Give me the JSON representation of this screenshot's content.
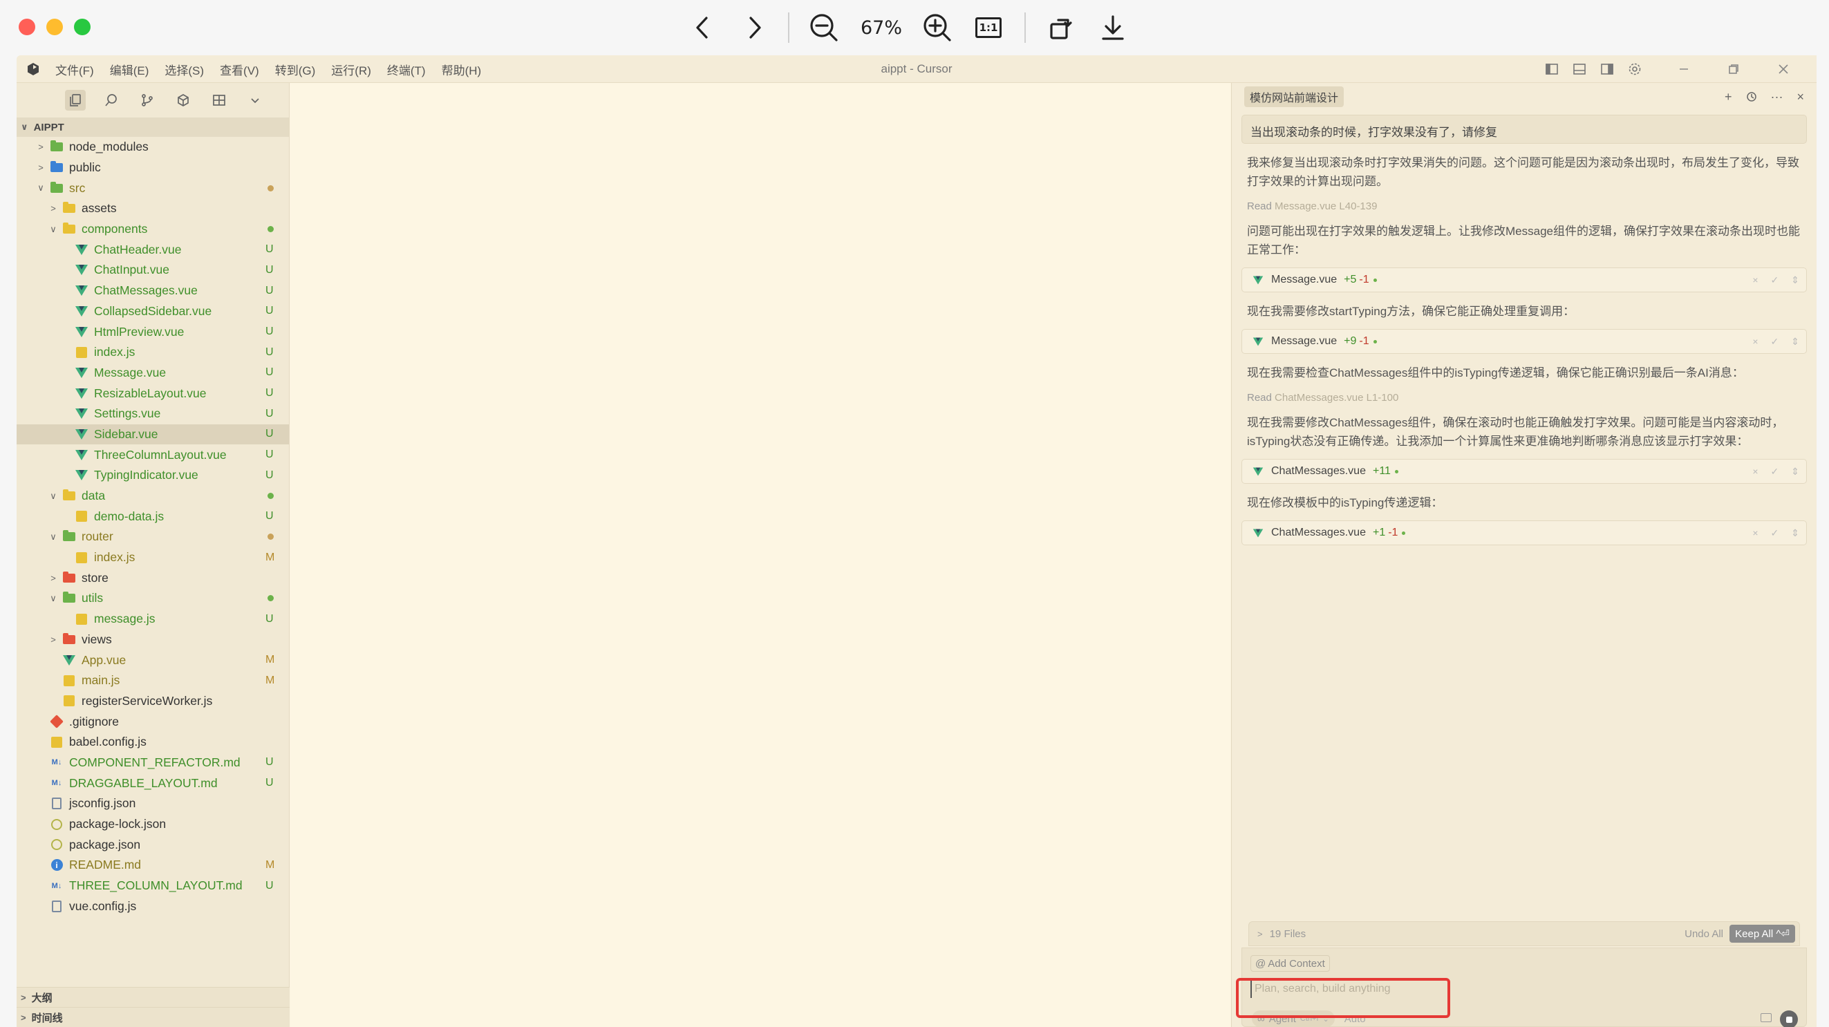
{
  "viewer": {
    "zoom": "67%",
    "actual_size_label": "1:1"
  },
  "window": {
    "title": "aippt - Cursor",
    "menu": [
      "文件(F)",
      "编辑(E)",
      "选择(S)",
      "查看(V)",
      "转到(G)",
      "运行(R)",
      "终端(T)",
      "帮助(H)"
    ]
  },
  "sidebar": {
    "root": "AIPPT",
    "tree": [
      {
        "indent": 0,
        "chev": ">",
        "icon": "folder-green",
        "name": "node_modules",
        "color": "",
        "status": ""
      },
      {
        "indent": 0,
        "chev": ">",
        "icon": "folder-blue",
        "name": "public",
        "color": "",
        "status": ""
      },
      {
        "indent": 0,
        "chev": "v",
        "icon": "folder-green",
        "name": "src",
        "color": "olive",
        "status": "dot-y"
      },
      {
        "indent": 1,
        "chev": ">",
        "icon": "folder-yellow",
        "name": "assets",
        "color": "",
        "status": ""
      },
      {
        "indent": 1,
        "chev": "v",
        "icon": "folder-yellow",
        "name": "components",
        "color": "green",
        "status": "dot-g"
      },
      {
        "indent": 2,
        "chev": "",
        "icon": "vue",
        "name": "ChatHeader.vue",
        "color": "green",
        "status": "U"
      },
      {
        "indent": 2,
        "chev": "",
        "icon": "vue",
        "name": "ChatInput.vue",
        "color": "green",
        "status": "U"
      },
      {
        "indent": 2,
        "chev": "",
        "icon": "vue",
        "name": "ChatMessages.vue",
        "color": "green",
        "status": "U"
      },
      {
        "indent": 2,
        "chev": "",
        "icon": "vue",
        "name": "CollapsedSidebar.vue",
        "color": "green",
        "status": "U"
      },
      {
        "indent": 2,
        "chev": "",
        "icon": "vue",
        "name": "HtmlPreview.vue",
        "color": "green",
        "status": "U"
      },
      {
        "indent": 2,
        "chev": "",
        "icon": "js",
        "name": "index.js",
        "color": "green",
        "status": "U"
      },
      {
        "indent": 2,
        "chev": "",
        "icon": "vue",
        "name": "Message.vue",
        "color": "green",
        "status": "U"
      },
      {
        "indent": 2,
        "chev": "",
        "icon": "vue",
        "name": "ResizableLayout.vue",
        "color": "green",
        "status": "U"
      },
      {
        "indent": 2,
        "chev": "",
        "icon": "vue",
        "name": "Settings.vue",
        "color": "green",
        "status": "U"
      },
      {
        "indent": 2,
        "chev": "",
        "icon": "vue",
        "name": "Sidebar.vue",
        "color": "green",
        "status": "U",
        "selected": true
      },
      {
        "indent": 2,
        "chev": "",
        "icon": "vue",
        "name": "ThreeColumnLayout.vue",
        "color": "green",
        "status": "U"
      },
      {
        "indent": 2,
        "chev": "",
        "icon": "vue",
        "name": "TypingIndicator.vue",
        "color": "green",
        "status": "U"
      },
      {
        "indent": 1,
        "chev": "v",
        "icon": "folder-yellow",
        "name": "data",
        "color": "green",
        "status": "dot-g"
      },
      {
        "indent": 2,
        "chev": "",
        "icon": "js",
        "name": "demo-data.js",
        "color": "green",
        "status": "U"
      },
      {
        "indent": 1,
        "chev": "v",
        "icon": "folder-green",
        "name": "router",
        "color": "olive",
        "status": "dot-y"
      },
      {
        "indent": 2,
        "chev": "",
        "icon": "js",
        "name": "index.js",
        "color": "olive",
        "status": "M"
      },
      {
        "indent": 1,
        "chev": ">",
        "icon": "folder-red",
        "name": "store",
        "color": "",
        "status": ""
      },
      {
        "indent": 1,
        "chev": "v",
        "icon": "folder-green",
        "name": "utils",
        "color": "green",
        "status": "dot-g"
      },
      {
        "indent": 2,
        "chev": "",
        "icon": "js",
        "name": "message.js",
        "color": "green",
        "status": "U"
      },
      {
        "indent": 1,
        "chev": ">",
        "icon": "folder-red",
        "name": "views",
        "color": "",
        "status": ""
      },
      {
        "indent": 1,
        "chev": "",
        "icon": "vue",
        "name": "App.vue",
        "color": "olive",
        "status": "M"
      },
      {
        "indent": 1,
        "chev": "",
        "icon": "js",
        "name": "main.js",
        "color": "olive",
        "status": "M"
      },
      {
        "indent": 1,
        "chev": "",
        "icon": "js",
        "name": "registerServiceWorker.js",
        "color": "",
        "status": ""
      },
      {
        "indent": 0,
        "chev": "",
        "icon": "git",
        "name": ".gitignore",
        "color": "",
        "status": ""
      },
      {
        "indent": 0,
        "chev": "",
        "icon": "js",
        "name": "babel.config.js",
        "color": "",
        "status": ""
      },
      {
        "indent": 0,
        "chev": "",
        "icon": "md",
        "name": "COMPONENT_REFACTOR.md",
        "color": "green",
        "status": "U"
      },
      {
        "indent": 0,
        "chev": "",
        "icon": "md",
        "name": "DRAGGABLE_LAYOUT.md",
        "color": "green",
        "status": "U"
      },
      {
        "indent": 0,
        "chev": "",
        "icon": "doc",
        "name": "jsconfig.json",
        "color": "",
        "status": ""
      },
      {
        "indent": 0,
        "chev": "",
        "icon": "json",
        "name": "package-lock.json",
        "color": "",
        "status": ""
      },
      {
        "indent": 0,
        "chev": "",
        "icon": "json",
        "name": "package.json",
        "color": "",
        "status": ""
      },
      {
        "indent": 0,
        "chev": "",
        "icon": "info",
        "name": "README.md",
        "color": "olive",
        "status": "M"
      },
      {
        "indent": 0,
        "chev": "",
        "icon": "md",
        "name": "THREE_COLUMN_LAYOUT.md",
        "color": "green",
        "status": "U"
      },
      {
        "indent": 0,
        "chev": "",
        "icon": "doc",
        "name": "vue.config.js",
        "color": "",
        "status": ""
      }
    ],
    "outline_label": "大纲",
    "timeline_label": "时间线"
  },
  "chat": {
    "tab_title": "模仿网站前端设计",
    "user_message": "当出现滚动条的时候，打字效果没有了，请修复",
    "ai_intro": "我来修复当出现滚动条时打字效果消失的问题。这个问题可能是因为滚动条出现时，布局发生了变化，导致打字效果的计算出现问题。",
    "read1_label": "Read",
    "read1_file": "Message.vue L40-139",
    "ai_p2": "问题可能出现在打字效果的触发逻辑上。让我修改Message组件的逻辑，确保打字效果在滚动条出现时也能正常工作：",
    "card1": {
      "file": "Message.vue",
      "add": "+5",
      "rem": "-1"
    },
    "ai_p3": "现在我需要修改startTyping方法，确保它能正确处理重复调用：",
    "card2": {
      "file": "Message.vue",
      "add": "+9",
      "rem": "-1"
    },
    "ai_p4": "现在我需要检查ChatMessages组件中的isTyping传递逻辑，确保它能正确识别最后一条AI消息：",
    "read2_label": "Read",
    "read2_file": "ChatMessages.vue L1-100",
    "ai_p5": "现在我需要修改ChatMessages组件，确保在滚动时也能正确触发打字效果。问题可能是当内容滚动时，isTyping状态没有正确传递。让我添加一个计算属性来更准确地判断哪条消息应该显示打字效果：",
    "card3": {
      "file": "ChatMessages.vue",
      "add": "+11",
      "rem": ""
    },
    "ai_p6": "现在修改模板中的isTyping传递逻辑：",
    "card4": {
      "file": "ChatMessages.vue",
      "add": "+1",
      "rem": "-1"
    },
    "files_summary": "19 Files",
    "undo_all": "Undo All",
    "keep_all": "Keep All ^⏎",
    "add_context": "Add Context",
    "input_placeholder": "Plan, search, build anything",
    "agent_label": "Agent",
    "agent_shortcut": "Ctrl+I",
    "model_label": "Auto"
  },
  "colors": {
    "accent_highlight": "#e53935",
    "untracked_green": "#3f8f2a",
    "modified_olive": "#b4892a",
    "editor_bg": "#fdf6e3"
  }
}
